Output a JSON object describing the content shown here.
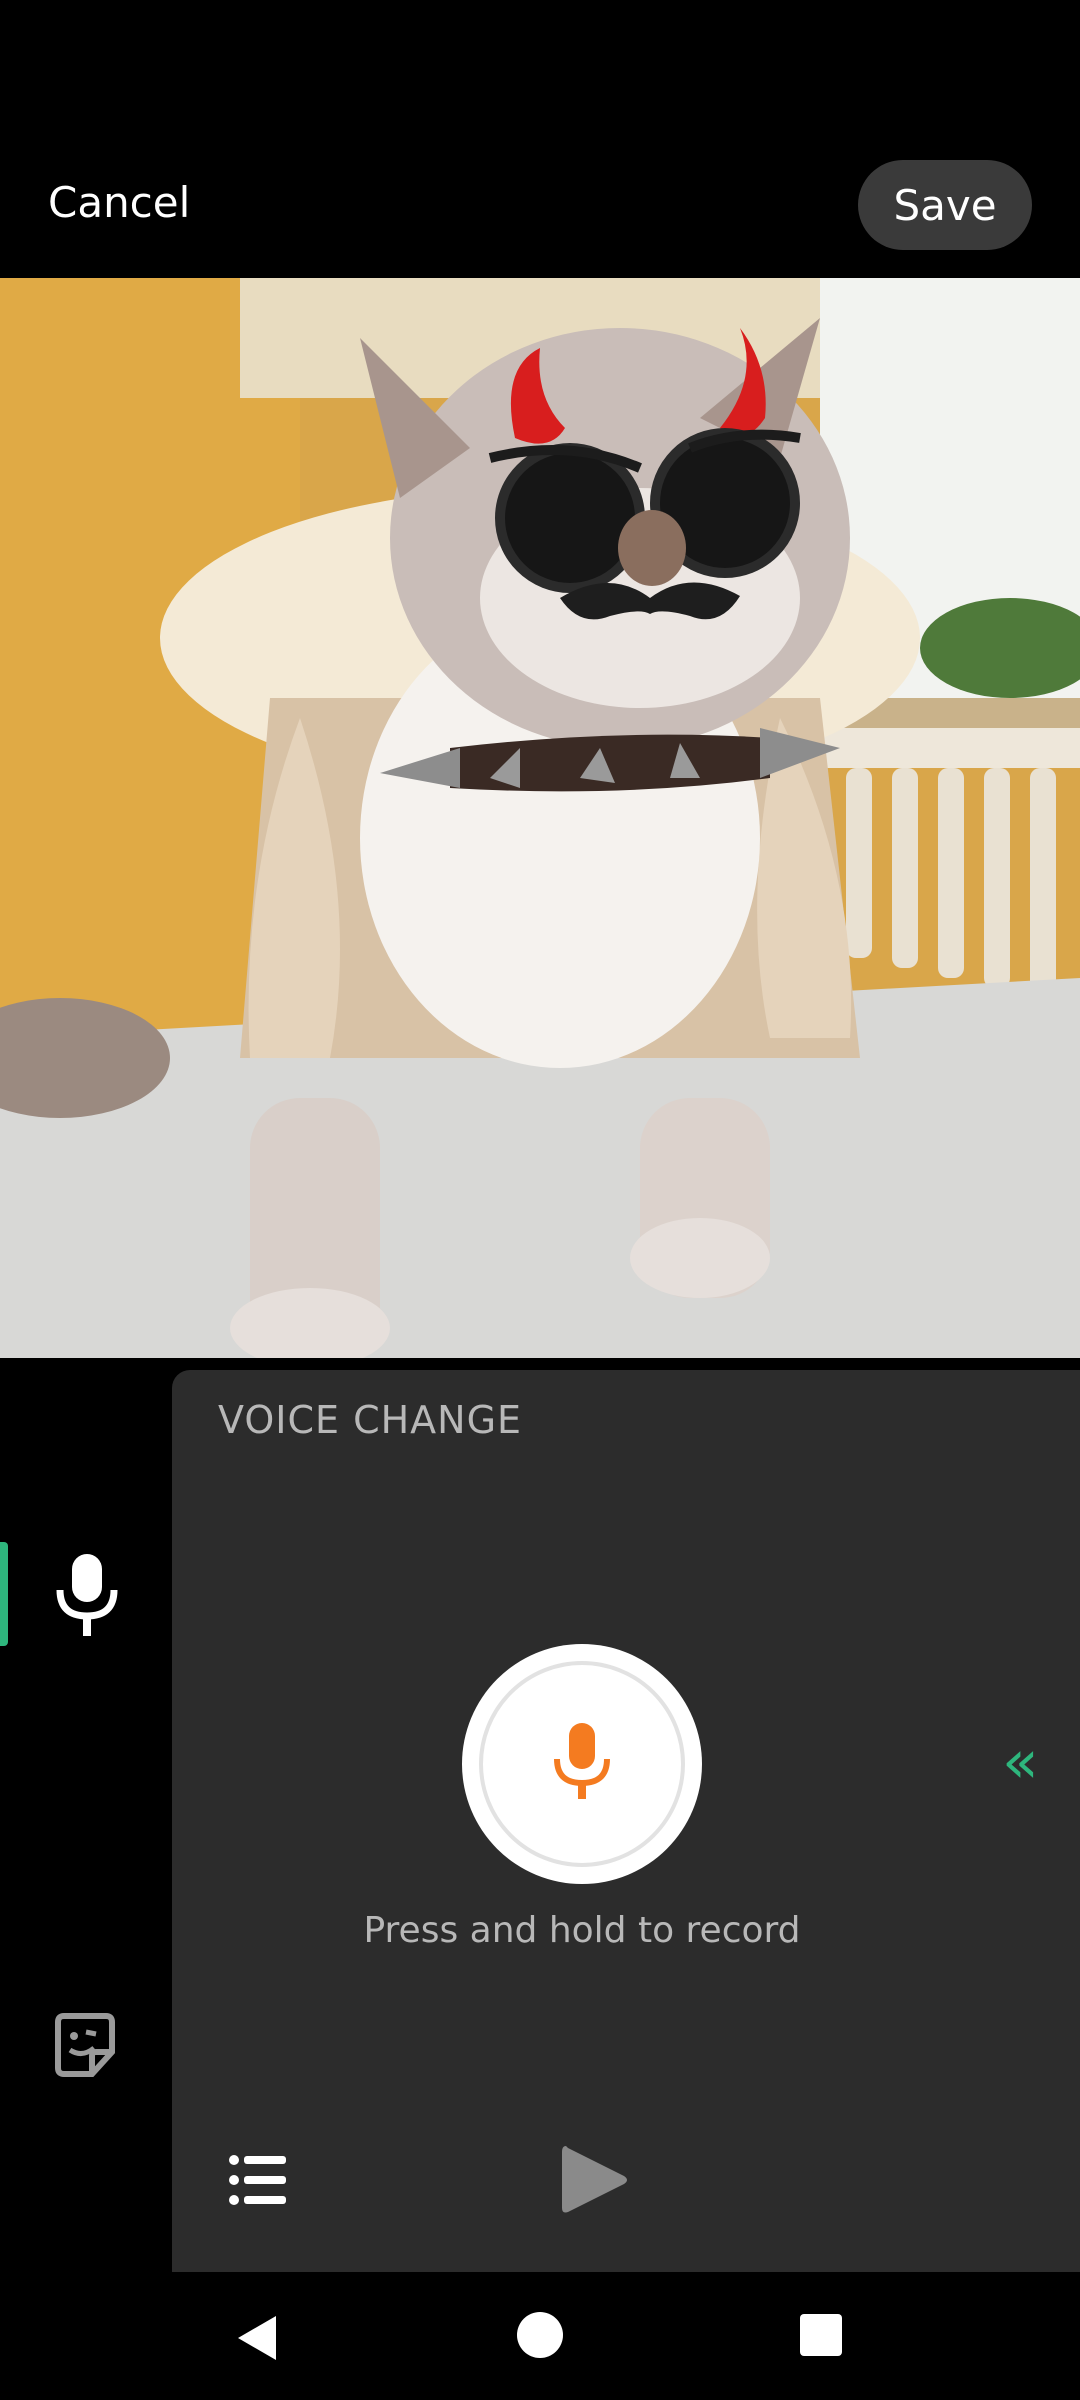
{
  "header": {
    "cancel_label": "Cancel",
    "save_label": "Save"
  },
  "photo": {
    "subject": "cat wearing jacket with devil horns, sunglasses, mustache and spiked collar stickers"
  },
  "panel": {
    "title": "VOICE CHANGE",
    "record_hint": "Press and hold to record",
    "collapse_glyph": "«"
  },
  "colors": {
    "accent_green": "#2eb67d",
    "record_orange": "#f47b20",
    "panel_bg": "#2c2c2c"
  },
  "icons": [
    "microphone-icon",
    "sticker-icon",
    "list-icon",
    "play-icon",
    "chevrons-left-icon",
    "back-icon",
    "home-icon",
    "recents-icon"
  ]
}
